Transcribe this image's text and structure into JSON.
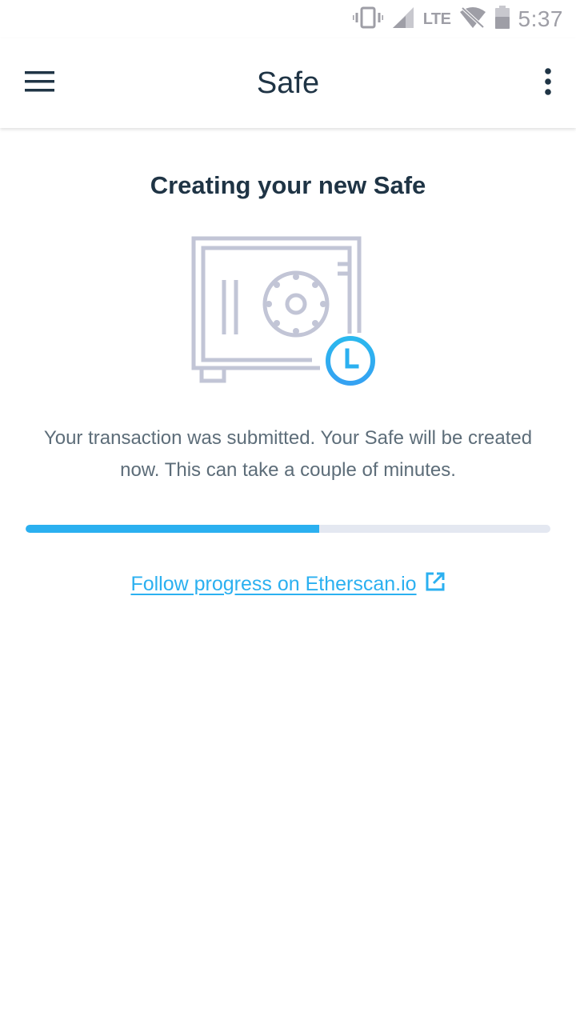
{
  "status_bar": {
    "time": "5:37",
    "network": "LTE",
    "icons": [
      "vibrate-icon",
      "signal-icon",
      "wifi-off-icon",
      "battery-icon"
    ]
  },
  "app_bar": {
    "title": "Safe",
    "menu_icon": "hamburger-menu-icon",
    "more_icon": "more-vertical-icon"
  },
  "main": {
    "heading": "Creating your new Safe",
    "illustration": "safe-clock-icon",
    "description": "Your transaction was submitted. Your Safe will be created now. This can take a couple of minutes.",
    "progress": 0.56,
    "link_label": "Follow progress on Etherscan.io",
    "link_icon": "external-link-icon"
  },
  "colors": {
    "accent": "#2bb0f0",
    "title_text": "#1f3445",
    "body_text": "#5d6d79",
    "progress_track": "#e4e8f1",
    "illustration_gray": "#c2c5d6"
  }
}
